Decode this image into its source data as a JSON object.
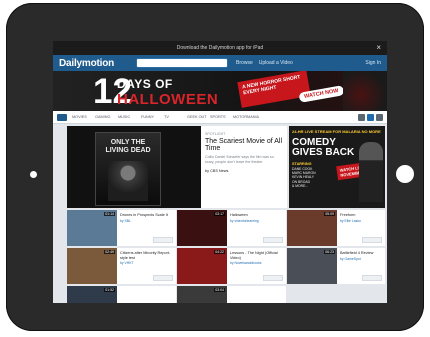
{
  "app_banner": {
    "text": "Download the Dailymotion app for iPad",
    "close": "×"
  },
  "header": {
    "logo_left": "Daily",
    "logo_right": "motion",
    "links": [
      "Browse",
      "Upload a Video"
    ],
    "sign_in": "Sign In"
  },
  "banner": {
    "number": "12",
    "line1": "DAYS OF",
    "line2": "HALLOWEEN",
    "promo": "A NEW HORROR SHORT EVERY NIGHT",
    "cta": "WATCH NOW"
  },
  "nav": {
    "items": [
      "MOVIES",
      "GAMING",
      "MUSIC",
      "FUNNY",
      "TV",
      "GEEK OUT",
      "SPORTS",
      "MOTORMANIA"
    ]
  },
  "feature": {
    "poster_title": "ONLY THE LIVING DEAD",
    "spotlight": "SPOTLIGHT",
    "title": "The Scariest Movie of All Time",
    "description": "Collin Daniel Schaefer says the film was so scary, people don't leave the theater",
    "by": "by CBS News"
  },
  "ad": {
    "top": "24-HR LIVE STREAM FOR MALARIA NO MORE",
    "title1": "COMEDY",
    "title2": "GIVES BACK",
    "starring_label": "STARRING",
    "names": [
      "DANE COOK",
      "MARC MARON",
      "KEVIN HEALY",
      "ON BROAD",
      "& MORE..."
    ],
    "cta_line1": "WATCH LIVE",
    "cta_line2": "NOVEMBER 6"
  },
  "cards": [
    {
      "title": "Drones in Prospects Scale It",
      "by": "by SBL",
      "views": "",
      "duration": "01:14",
      "color": "#5b7a96"
    },
    {
      "title": "Halloween",
      "by": "by videoforlearning",
      "views": "",
      "duration": "03:17",
      "color": "#3a1010"
    },
    {
      "title": "Lessons - The Night (Official Video)",
      "by": "by Novelsandobooks",
      "views": "",
      "duration": "04:22",
      "color": "#8a1a1a"
    },
    {
      "title": "Freeform",
      "by": "by Ellie Lasko",
      "views": "",
      "duration": "05:09",
      "color": "#6a3a2a"
    },
    {
      "title": "Citizens after Minority Report-style test",
      "by": "by VHKT",
      "views": "",
      "duration": "02:49",
      "color": "#7a5a3a"
    },
    {
      "title": "",
      "by": "",
      "views": "",
      "duration": "01:52",
      "color": "#2f3a4a"
    },
    {
      "title": "",
      "by": "",
      "views": "",
      "duration": "03:04",
      "color": "#3a3a3a"
    },
    {
      "title": "Battlefield 4 Review",
      "by": "by GameSpot",
      "views": "",
      "duration": "06:23",
      "color": "#4a4e56"
    }
  ]
}
